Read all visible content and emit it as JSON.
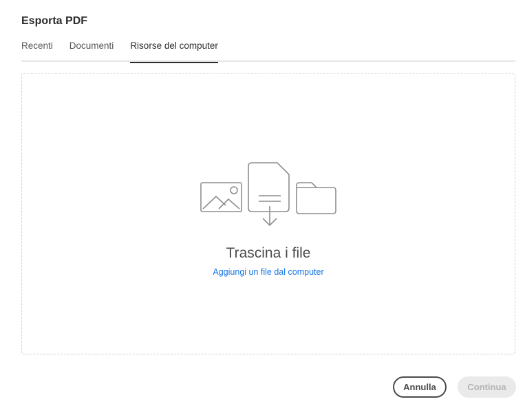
{
  "dialog": {
    "title": "Esporta PDF"
  },
  "tabs": [
    {
      "label": "Recenti",
      "selected": false
    },
    {
      "label": "Documenti",
      "selected": false
    },
    {
      "label": "Risorse del computer",
      "selected": true
    }
  ],
  "dropzone": {
    "title": "Trascina i file",
    "link": "Aggiungi un file dal computer",
    "icons": [
      "image-icon",
      "file-download-icon",
      "folder-icon"
    ]
  },
  "footer": {
    "cancel_label": "Annulla",
    "continue_label": "Continua"
  },
  "colors": {
    "link": "#1473e6",
    "icon_stroke": "#8e8e8e",
    "disabled_bg": "#eaeaea",
    "disabled_text": "#b3b3b3"
  }
}
